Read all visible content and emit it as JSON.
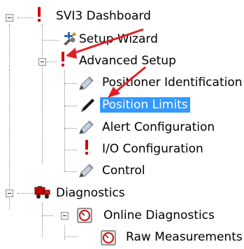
{
  "tree": {
    "root": {
      "label": "SVI3 Dashboard",
      "icon": "error-exclamation-icon"
    },
    "setup_wizard": {
      "label": "Setup Wizard",
      "icon": "wizard-wrench-icon"
    },
    "advanced_setup": {
      "label": "Advanced Setup",
      "icon": "error-exclamation-icon"
    },
    "positioner_identification": {
      "label": "Positioner Identification",
      "icon": "pencil-icon"
    },
    "position_limits": {
      "label": "Position Limits",
      "icon": "pen-icon",
      "selected": true
    },
    "alert_configuration": {
      "label": "Alert Configuration",
      "icon": "pencil-icon"
    },
    "io_configuration": {
      "label": "I/O Configuration",
      "icon": "error-exclamation-icon"
    },
    "control": {
      "label": "Control",
      "icon": "pencil-icon"
    },
    "diagnostics": {
      "label": "Diagnostics",
      "icon": "diagnostics-truck-icon"
    },
    "online_diagnostics": {
      "label": "Online Diagnostics",
      "icon": "gauge-icon"
    },
    "raw_measurements": {
      "label": "Raw Measurements",
      "icon": "gauge-icon"
    }
  },
  "colors": {
    "selection": "#3399ff",
    "error": "#d60000",
    "annotation_arrow": "#e41e26"
  }
}
